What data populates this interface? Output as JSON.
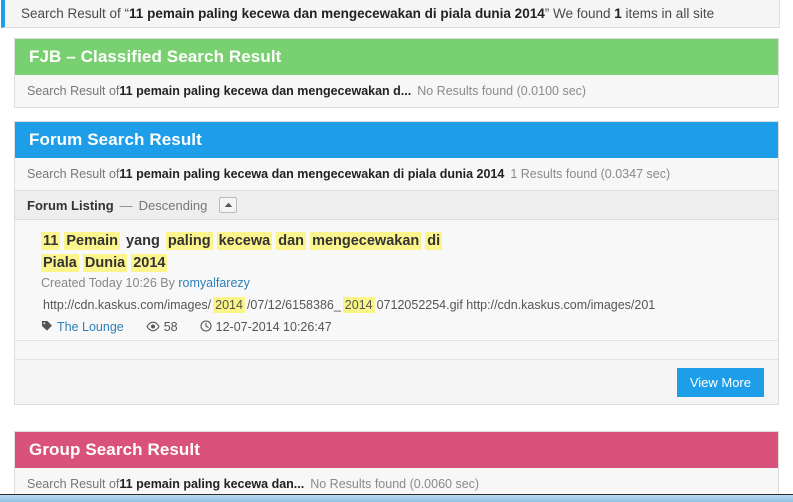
{
  "top_strip": {
    "prefix": "Search Result of “",
    "query": "11 pemain paling kecewa dan mengecewakan di piala dunia 2014",
    "suffix_open": "” We found ",
    "count": "1",
    "suffix_close": " items in all site"
  },
  "panels": {
    "fjb": {
      "title": "FJB – Classified Search Result",
      "color": "#79d070",
      "sub_prefix": "Search Result of ",
      "sub_query": "11 pemain paling kecewa dan mengecewakan d...",
      "sub_meta": "No Results found (0.0100 sec)"
    },
    "forum": {
      "title": "Forum Search Result",
      "color": "#1e9ee8",
      "sub_prefix": "Search Result of ",
      "sub_query": "11 pemain paling kecewa dan mengecewakan di piala dunia 2014",
      "sub_meta": "1 Results found (0.0347 sec)",
      "listing": {
        "label": "Forum Listing",
        "dash": "—",
        "order": "Descending",
        "collapse_icon": "▲"
      },
      "result": {
        "title_tokens": [
          {
            "text": "11",
            "highlight": true
          },
          {
            "text": "Pemain",
            "highlight": true
          },
          {
            "text": "yang",
            "highlight": false
          },
          {
            "text": "paling",
            "highlight": true
          },
          {
            "text": "kecewa",
            "highlight": true
          },
          {
            "text": "dan",
            "highlight": true
          },
          {
            "text": "mengecewakan",
            "highlight": true
          },
          {
            "text": "di",
            "highlight": true
          },
          {
            "text": "Piala",
            "highlight": true
          },
          {
            "text": "Dunia",
            "highlight": true
          },
          {
            "text": "2014",
            "highlight": true
          }
        ],
        "created_text": "Created Today 10:26 By ",
        "author": "romyalfarezy",
        "url_tokens": [
          {
            "text": "http://cdn.kaskus.com/images/",
            "highlight": false
          },
          {
            "text": "2014",
            "highlight": true
          },
          {
            "text": "/07/12/6158386_",
            "highlight": false
          },
          {
            "text": "2014",
            "highlight": true
          },
          {
            "text": "0712052254.gif http://cdn.kaskus.com/images/201",
            "highlight": false
          }
        ],
        "tag_icon": "🏷",
        "forum_name": "The Lounge",
        "eye_icon": "👁",
        "views": "58",
        "clock_icon": "🕒",
        "timestamp": "12-07-2014 10:26:47"
      },
      "view_more_label": "View More"
    },
    "group": {
      "title": "Group Search Result",
      "color": "#d8527c",
      "sub_prefix": "Search Result of ",
      "sub_query": "11 pemain paling kecewa dan...",
      "sub_meta": "No Results found (0.0060 sec)"
    }
  }
}
